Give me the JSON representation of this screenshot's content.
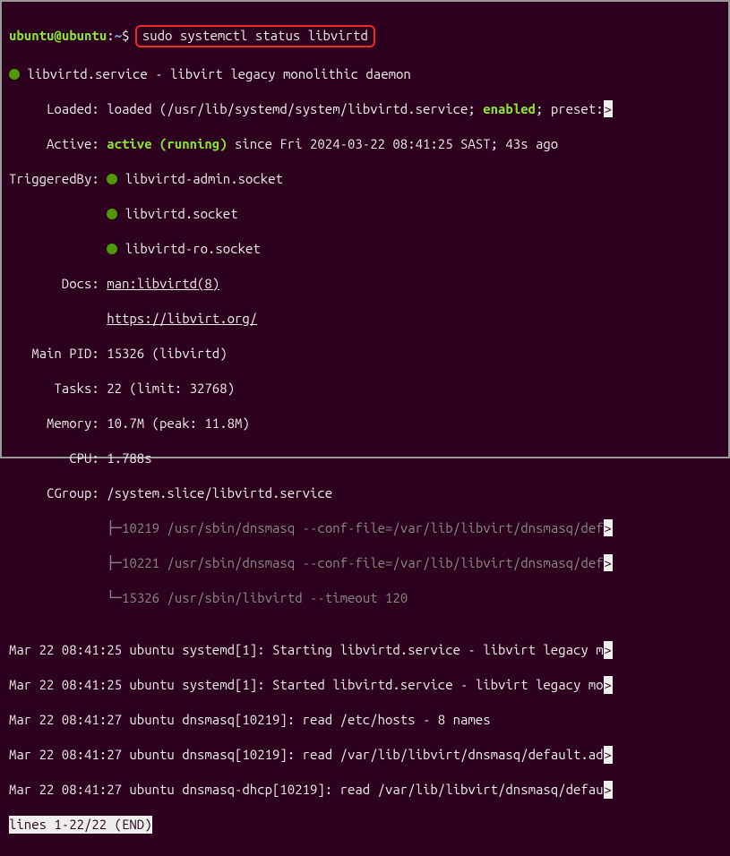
{
  "prompt": {
    "user": "ubuntu",
    "at": "@",
    "host": "ubuntu",
    "colon": ":",
    "path": "~",
    "dollar": "$ "
  },
  "command": "sudo systemctl status libvirtd",
  "svc": {
    "header": " libvirtd.service - libvirt legacy monolithic daemon",
    "loaded_label": "     Loaded: ",
    "loaded_pre": "loaded (/usr/lib/systemd/system/libvirtd.service; ",
    "loaded_enabled": "enabled",
    "loaded_post": "; preset:",
    "active_label": "     Active: ",
    "active_state": "active (running)",
    "active_since": " since Fri 2024-03-22 08:41:25 SAST; 43s ago",
    "trig_label": "TriggeredBy: ",
    "trig1": " libvirtd-admin.socket",
    "trig_pad": "             ",
    "trig2": " libvirtd.socket",
    "trig3": " libvirtd-ro.socket",
    "docs_label": "       Docs: ",
    "docs1": "man:libvirtd(8)",
    "docs_pad": "             ",
    "docs2": "https://libvirt.org/",
    "pid_label": "   Main PID: ",
    "pid": "15326 (libvirtd)",
    "tasks_label": "      Tasks: ",
    "tasks": "22 (limit: 32768)",
    "mem_label": "     Memory: ",
    "mem": "10.7M (peak: 11.8M)",
    "cpu_label": "        CPU: ",
    "cpu": "1.788s",
    "cgroup_label": "     CGroup: ",
    "cgroup": "/system.slice/libvirtd.service",
    "cg_pad": "             ",
    "cg1_tree": "├─",
    "cg1": "10219 /usr/sbin/dnsmasq --conf-file=/var/lib/libvirt/dnsmasq/def",
    "cg2_tree": "├─",
    "cg2": "10221 /usr/sbin/dnsmasq --conf-file=/var/lib/libvirt/dnsmasq/def",
    "cg3_tree": "└─",
    "cg3": "15326 /usr/sbin/libvirtd --timeout 120"
  },
  "blank": "",
  "log": {
    "l1": "Mar 22 08:41:25 ubuntu systemd[1]: Starting libvirtd.service - libvirt legacy m",
    "l2": "Mar 22 08:41:25 ubuntu systemd[1]: Started libvirtd.service - libvirt legacy mo",
    "l3": "Mar 22 08:41:27 ubuntu dnsmasq[10219]: read /etc/hosts - 8 names",
    "l4": "Mar 22 08:41:27 ubuntu dnsmasq[10219]: read /var/lib/libvirt/dnsmasq/default.ad",
    "l5": "Mar 22 08:41:27 ubuntu dnsmasq-dhcp[10219]: read /var/lib/libvirt/dnsmasq/defau"
  },
  "pager": "lines 1-22/22 (END)",
  "arrow": ">"
}
